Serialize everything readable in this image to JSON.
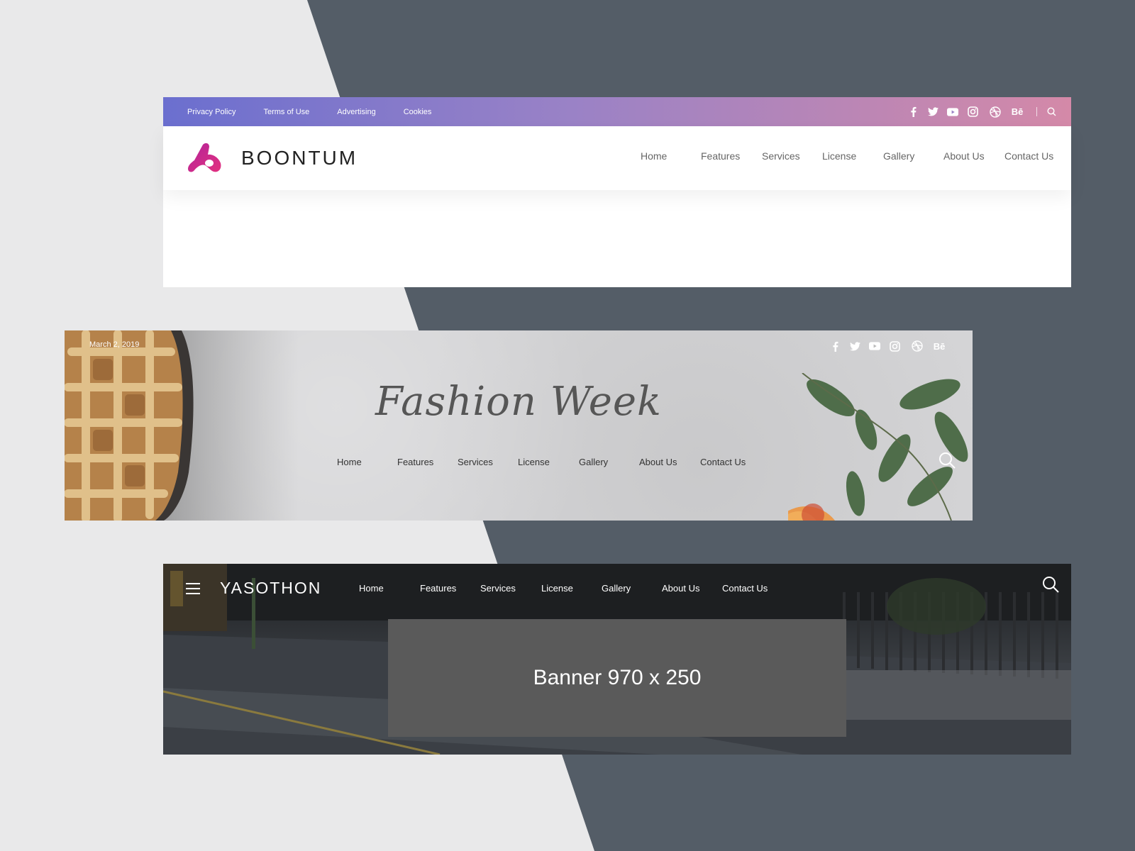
{
  "colors": {
    "page_light": "#e9e9ea",
    "page_dark": "#545d67",
    "gradient_start": "#6b6fcf",
    "gradient_end": "#d489a8",
    "logo_magenta": "#c9268f",
    "banner_gray": "#5a5a5a"
  },
  "header1": {
    "top_links": [
      "Privacy Policy",
      "Terms of Use",
      "Advertising",
      "Cookies"
    ],
    "social_icons": [
      "facebook-icon",
      "twitter-icon",
      "youtube-icon",
      "instagram-icon",
      "dribbble-icon",
      "behance-icon"
    ],
    "behance_text": "Bē",
    "brand": "BOONTUM",
    "nav": [
      "Home",
      "Features",
      "Services",
      "License",
      "Gallery",
      "About Us",
      "Contact Us"
    ]
  },
  "header2": {
    "date": "March 2, 2019",
    "social_icons": [
      "facebook-icon",
      "twitter-icon",
      "youtube-icon",
      "instagram-icon",
      "dribbble-icon",
      "behance-icon"
    ],
    "behance_text": "Bē",
    "title": "Fashion Week",
    "nav": [
      "Home",
      "Features",
      "Services",
      "License",
      "Gallery",
      "About Us",
      "Contact Us"
    ]
  },
  "header3": {
    "brand": "YASOTHON",
    "nav": [
      "Home",
      "Features",
      "Services",
      "License",
      "Gallery",
      "About Us",
      "Contact Us"
    ],
    "banner_text": "Banner 970 x 250"
  }
}
